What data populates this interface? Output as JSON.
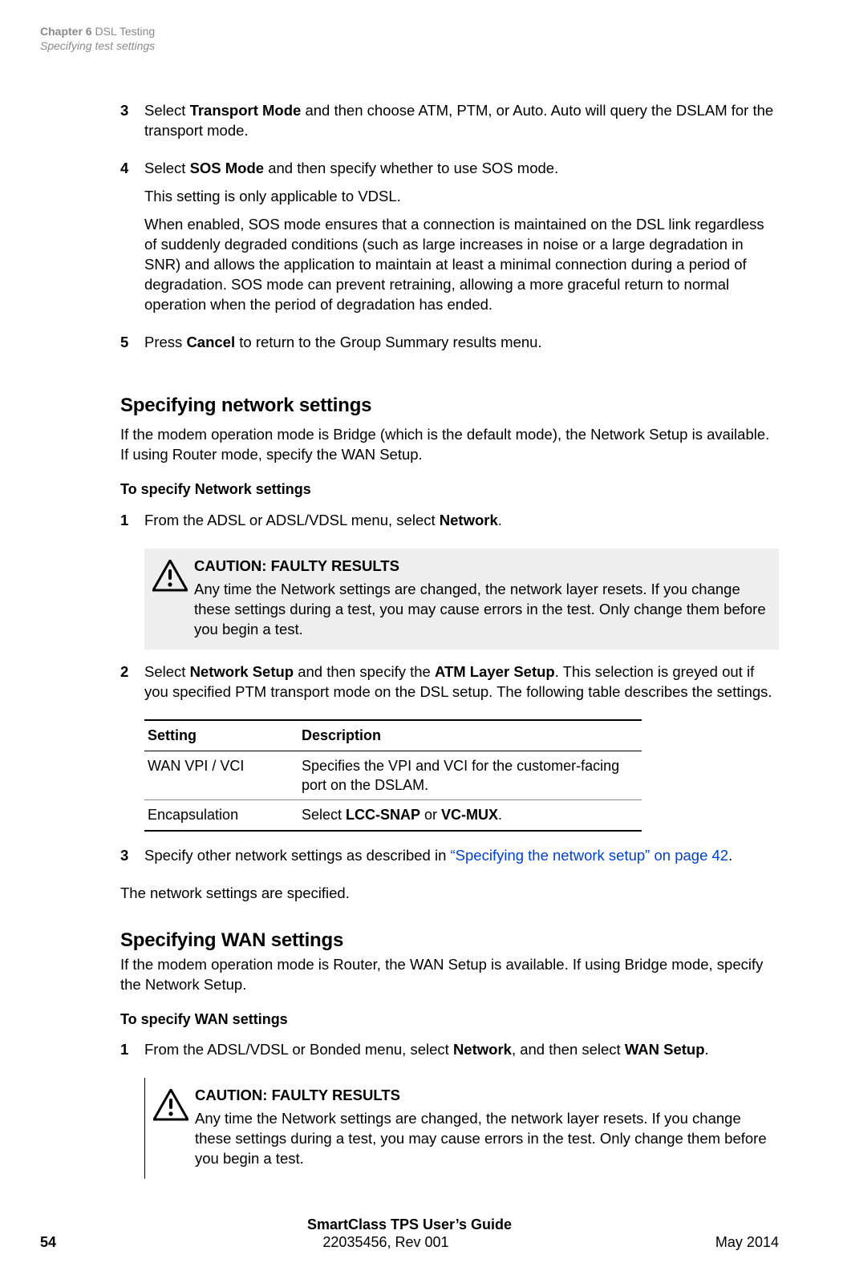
{
  "header": {
    "chapter_label": "Chapter 6",
    "chapter_title": "DSL Testing",
    "section_title": "Specifying test settings"
  },
  "steps_top": [
    {
      "num": "3",
      "paragraphs": [
        {
          "parts": [
            "Select ",
            {
              "b": "Transport Mode"
            },
            " and then choose ATM, PTM, or Auto. Auto will query the DSLAM for the transport mode."
          ]
        }
      ]
    },
    {
      "num": "4",
      "paragraphs": [
        {
          "parts": [
            "Select ",
            {
              "b": "SOS Mode"
            },
            " and then specify whether to use SOS mode."
          ]
        },
        {
          "parts": [
            "This setting is only applicable to VDSL."
          ]
        },
        {
          "parts": [
            "When enabled, SOS mode ensures that a connection is maintained on the DSL link regardless of suddenly degraded conditions (such as large increases in noise or a large degradation in SNR) and allows the application to maintain at least a minimal connection during a period of degradation. SOS mode can prevent retraining, allowing a more graceful return to normal operation when the period of degradation has ended."
          ]
        }
      ]
    },
    {
      "num": "5",
      "paragraphs": [
        {
          "parts": [
            "Press ",
            {
              "b": "Cancel"
            },
            " to return to the Group Summary results menu."
          ]
        }
      ]
    }
  ],
  "section_network": {
    "title": "Specifying network settings",
    "lead": "If the modem operation mode is Bridge (which is the default mode), the Network Setup is available. If using Router mode, specify the WAN Setup.",
    "subhead": "To specify Network settings",
    "steps": [
      {
        "num": "1",
        "paragraphs": [
          {
            "parts": [
              "From the ADSL or ADSL/VDSL menu, select ",
              {
                "b": "Network"
              },
              "."
            ]
          }
        ]
      }
    ],
    "caution": {
      "title": "CAUTION: FAULTY RESULTS",
      "body": "Any time the Network settings are changed, the network layer resets. If you change these settings during a test, you may cause errors in the test. Only change them before you begin a test."
    },
    "step2": {
      "num": "2",
      "paragraphs": [
        {
          "parts": [
            "Select ",
            {
              "b": "Network Setup"
            },
            " and then specify the ",
            {
              "b": "ATM Layer Setup"
            },
            ". This selection is greyed out if you specified PTM transport mode on the DSL setup. The following table describes the settings."
          ]
        }
      ]
    },
    "table": {
      "headers": [
        "Setting",
        "Description"
      ],
      "rows": [
        {
          "setting": "WAN VPI / VCI",
          "desc_parts": [
            "Specifies the VPI and VCI for the customer-facing port on the DSLAM."
          ]
        },
        {
          "setting": "Encapsulation",
          "desc_parts": [
            "Select ",
            {
              "b": "LCC-SNAP"
            },
            " or ",
            {
              "b": "VC-MUX"
            },
            "."
          ]
        }
      ]
    },
    "step3": {
      "num": "3",
      "paragraphs": [
        {
          "parts": [
            " Specify other network settings as described in ",
            {
              "link": "“Specifying the network setup” on page 42"
            },
            "."
          ]
        }
      ]
    },
    "closing": "The network settings are specified."
  },
  "section_wan": {
    "title": "Specifying WAN settings",
    "lead": "If the modem operation mode is Router, the WAN Setup is available. If using Bridge mode, specify the Network Setup.",
    "subhead": "To specify WAN settings",
    "steps": [
      {
        "num": "1",
        "paragraphs": [
          {
            "parts": [
              "From the ADSL/VDSL or Bonded menu, select ",
              {
                "b": "Network"
              },
              ", and then select ",
              {
                "b": "WAN Setup"
              },
              "."
            ]
          }
        ]
      }
    ],
    "caution": {
      "title": "CAUTION: FAULTY RESULTS",
      "body": "Any time the Network settings are changed, the network layer resets. If you change these settings during a test, you may cause errors in the test. Only change them before you begin a test."
    }
  },
  "footer": {
    "guide_title": "SmartClass TPS User’s Guide",
    "doc_number": "22035456, Rev 001",
    "page_number": "54",
    "date": "May 2014"
  }
}
